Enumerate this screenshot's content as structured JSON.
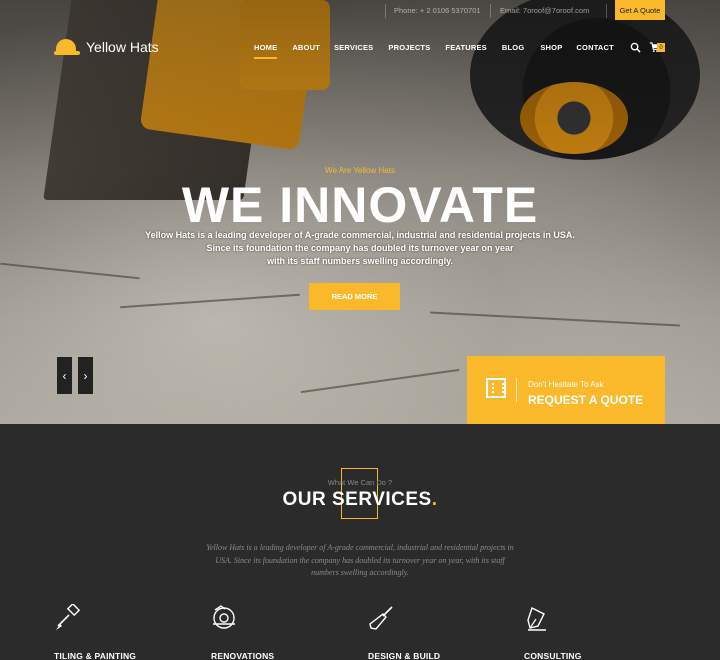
{
  "topbar": {
    "phone": "Phone: + 2 0106 5370701",
    "email": "Email: 7oroof@7oroof.com",
    "quote_button": "Get A Quote"
  },
  "brand": {
    "name": "Yellow Hats"
  },
  "nav": {
    "items": [
      "HOME",
      "ABOUT",
      "SERVICES",
      "PROJECTS",
      "FEATURES",
      "BLOG",
      "SHOP",
      "CONTACT"
    ],
    "active": "HOME",
    "cart_count": "0"
  },
  "hero": {
    "subtitle": "We Are Yellow Hats",
    "title": "WE INNOVATE",
    "desc_line1": "Yellow Hats is a leading developer of A-grade commercial, industrial and residential projects in USA.",
    "desc_line2": "Since its foundation the company has doubled its turnover year on year",
    "desc_line3": "with its staff numbers swelling accordingly.",
    "button": "READ MORE",
    "prev": "‹",
    "next": "›"
  },
  "request_quote": {
    "small": "Don't Hesitate To Ask",
    "big": "REQUEST A QUOTE"
  },
  "services": {
    "kicker": "What We Can Do ?",
    "title": "OUR SERVICES",
    "title_dot": ".",
    "desc": "Yellow Hats is a leading developer of A-grade commercial, industrial and residential projects in USA. Since its foundation the company has doubled its turnover year on year, with its staff numbers swelling accordingly.",
    "items": [
      {
        "label": "TILING & PAINTING",
        "icon": "paint-brush-icon"
      },
      {
        "label": "RENOVATIONS",
        "icon": "circular-saw-icon"
      },
      {
        "label": "DESIGN & BUILD",
        "icon": "trowel-icon"
      },
      {
        "label": "CONSULTING",
        "icon": "pen-nib-icon"
      }
    ]
  },
  "colors": {
    "accent": "#f9b92a",
    "dark": "#2b2b2b"
  }
}
